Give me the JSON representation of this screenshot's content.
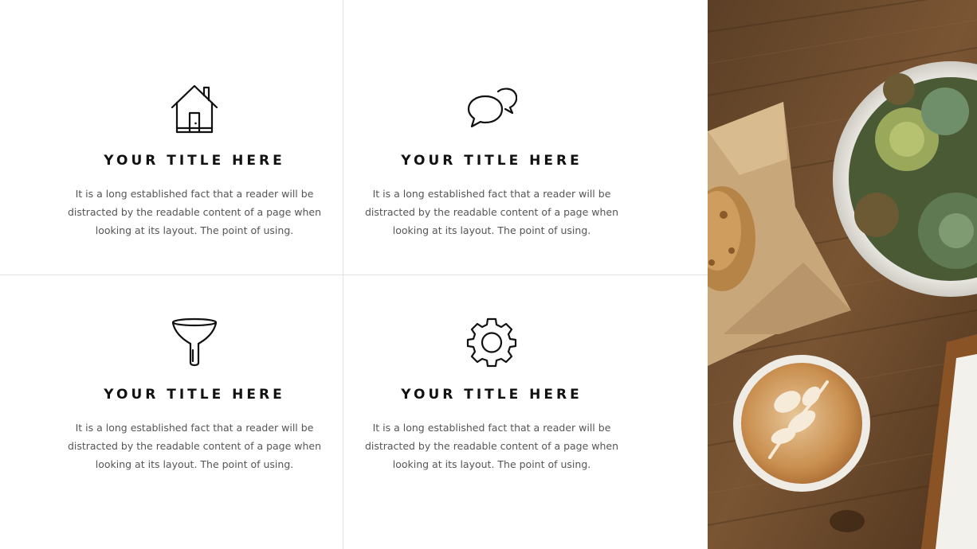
{
  "features": [
    {
      "icon": "house-icon",
      "title": "YOUR TITLE HERE",
      "body": "It is a long established fact that a reader will be distracted by the readable content of a page when looking at its layout. The point of using."
    },
    {
      "icon": "chat-bubbles-icon",
      "title": "YOUR TITLE HERE",
      "body": "It is a long established fact that a reader will be distracted by the readable content of a page when looking at its layout. The point of using."
    },
    {
      "icon": "funnel-icon",
      "title": "YOUR TITLE HERE",
      "body": "It is a long established fact that a reader will be distracted by the readable content of a page when looking at its layout. The point of using."
    },
    {
      "icon": "gear-icon",
      "title": "YOUR TITLE HERE",
      "body": "It is a long established fact that a reader will be distracted by the readable content of a page when looking at its layout. The point of using."
    }
  ],
  "photo": {
    "subject": "coffee-table-photo"
  },
  "colors": {
    "background": "#ffffff",
    "title": "#111111",
    "body": "#555555",
    "divider": "#e3e3e3",
    "wood": "#6b4a2b"
  }
}
